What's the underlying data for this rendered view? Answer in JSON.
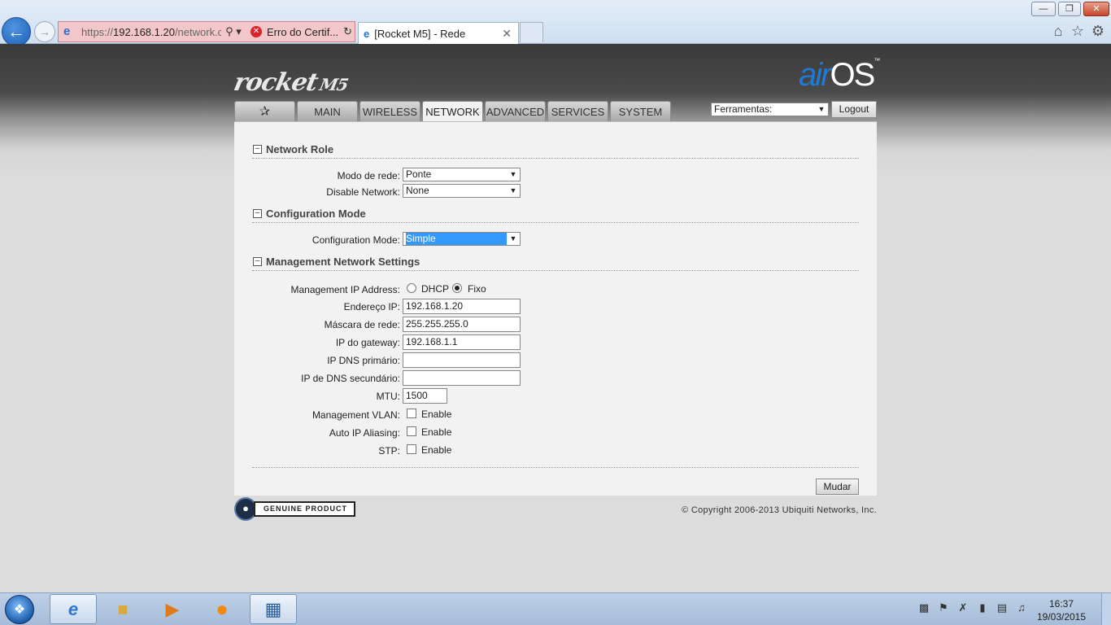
{
  "browser": {
    "url_base": "https://",
    "url_host": "192.168.1.20",
    "url_path": "/network.cgi",
    "cert_error": "Erro do Certif...",
    "tab_title": "[Rocket M5] - Rede"
  },
  "branding": {
    "product": "rocket",
    "model": "M5",
    "os_air": "air",
    "os_os": "OS",
    "tm": "™"
  },
  "nav": {
    "tabs": [
      "MAIN",
      "WIRELESS",
      "NETWORK",
      "ADVANCED",
      "SERVICES",
      "SYSTEM"
    ],
    "active": "NETWORK",
    "tools_select": "Ferramentas:",
    "logout": "Logout"
  },
  "sections": {
    "network_role": "Network Role",
    "config_mode": "Configuration Mode",
    "mgmt": "Management Network Settings"
  },
  "form": {
    "modo_label": "Modo de rede:",
    "modo_value": "Ponte",
    "disable_label": "Disable Network:",
    "disable_value": "None",
    "config_label": "Configuration Mode:",
    "config_value": "Simple",
    "mgmt_ip_label": "Management IP Address:",
    "dhcp": "DHCP",
    "fixo": "Fixo",
    "endereco_label": "Endereço IP:",
    "endereco_value": "192.168.1.20",
    "mascara_label": "Máscara de rede:",
    "mascara_value": "255.255.255.0",
    "gateway_label": "IP do gateway:",
    "gateway_value": "192.168.1.1",
    "dns1_label": "IP DNS primário:",
    "dns1_value": "",
    "dns2_label": "IP de DNS secundário:",
    "dns2_value": "",
    "mtu_label": "MTU:",
    "mtu_value": "1500",
    "vlan_label": "Management VLAN:",
    "alias_label": "Auto IP Aliasing:",
    "stp_label": "STP:",
    "enable": "Enable",
    "apply": "Mudar"
  },
  "footer": {
    "genuine": "GENUINE PRODUCT",
    "copyright": "© Copyright 2006-2013 Ubiquiti Networks, Inc."
  },
  "taskbar": {
    "time": "16:37",
    "date": "19/03/2015"
  }
}
